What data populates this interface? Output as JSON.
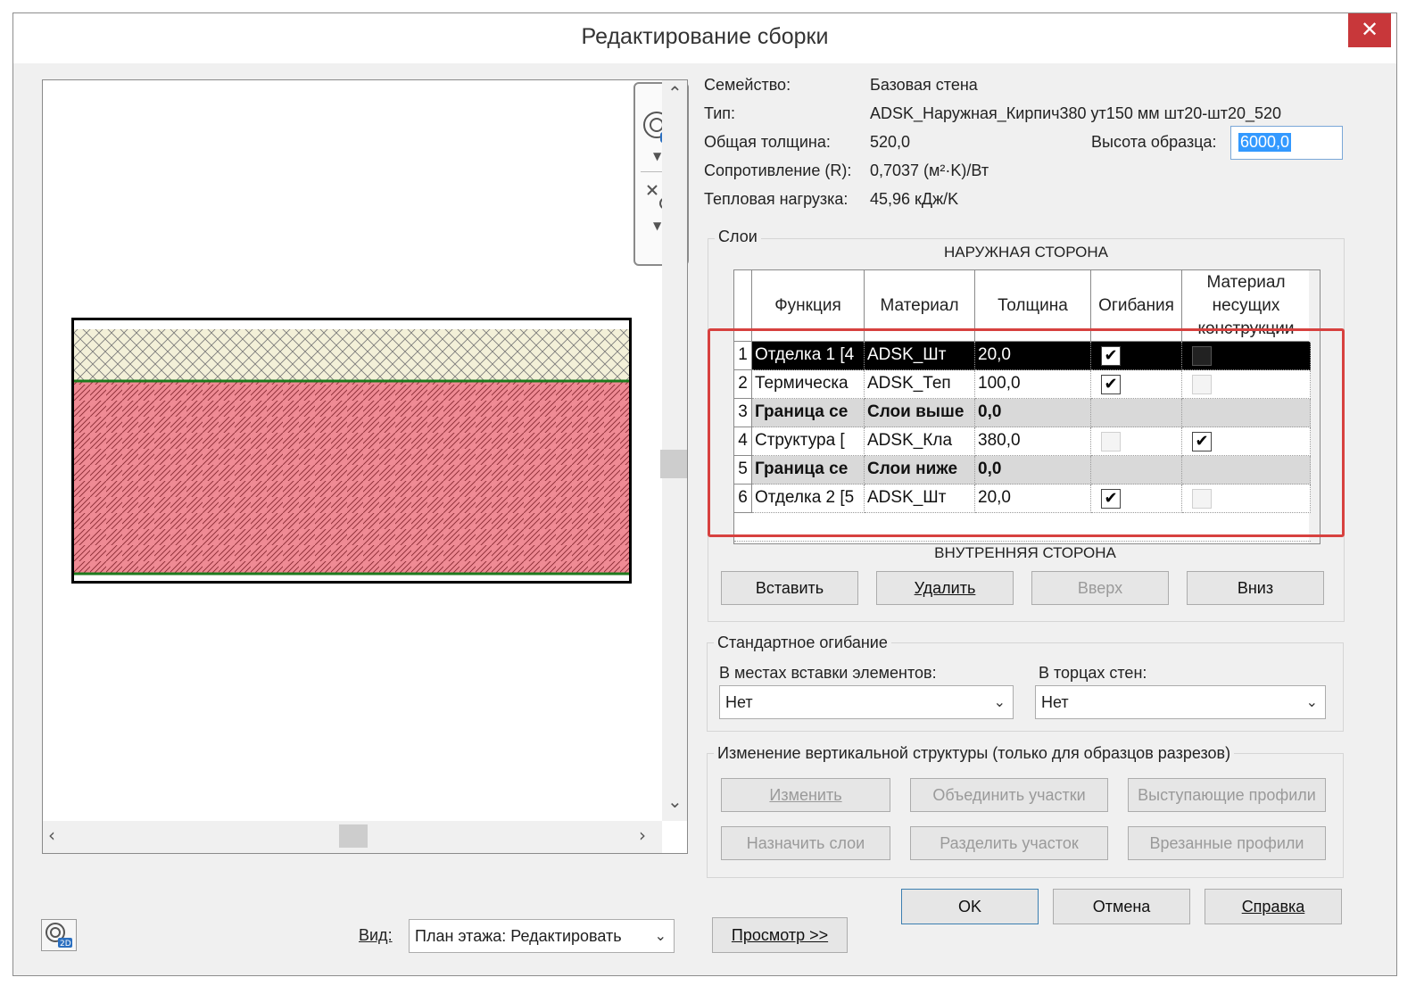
{
  "window": {
    "title": "Редактирование сборки",
    "close_glyph": "✕"
  },
  "info": {
    "family_label": "Семейство:",
    "family_value": "Базовая стена",
    "type_label": "Тип:",
    "type_value": "ADSK_Наружная_Кирпич380 ут150 мм шт20-шт20_520",
    "thickness_label": "Общая толщина:",
    "thickness_value": "520,0",
    "resistance_label": "Сопротивление (R):",
    "resistance_value": "0,7037 (м²·K)/Вт",
    "thermal_label": "Тепловая нагрузка:",
    "thermal_value": "45,96 кДж/K",
    "sample_height_label": "Высота образца:",
    "sample_height_value": "6000,0"
  },
  "layers": {
    "group_title": "Слои",
    "exterior_label": "НАРУЖНАЯ СТОРОНА",
    "interior_label": "ВНУТРЕННЯЯ СТОРОНА",
    "columns": [
      "Функция",
      "Материал",
      "Толщина",
      "Огибания",
      "Материал несущих конструкции"
    ],
    "rows": [
      {
        "num": "1",
        "function": "Отделка 1 [4",
        "material": "ADSK_Шт",
        "thickness": "20,0",
        "wrap": true,
        "structural": false,
        "selected": true,
        "bold": false
      },
      {
        "num": "2",
        "function": "Термическа",
        "material": "ADSK_Теп",
        "thickness": "100,0",
        "wrap": true,
        "structural": false,
        "selected": false,
        "bold": false
      },
      {
        "num": "3",
        "function": "Граница се",
        "material": "Слои выше",
        "thickness": "0,0",
        "wrap": null,
        "structural": null,
        "selected": false,
        "bold": true
      },
      {
        "num": "4",
        "function": "Структура [",
        "material": "ADSK_Кла",
        "thickness": "380,0",
        "wrap": false,
        "structural": true,
        "selected": false,
        "bold": false
      },
      {
        "num": "5",
        "function": "Граница се",
        "material": "Слои ниже",
        "thickness": "0,0",
        "wrap": null,
        "structural": null,
        "selected": false,
        "bold": true
      },
      {
        "num": "6",
        "function": "Отделка 2 [5",
        "material": "ADSK_Шт",
        "thickness": "20,0",
        "wrap": true,
        "structural": false,
        "selected": false,
        "bold": false
      }
    ],
    "buttons": {
      "insert": "Вставить",
      "delete": "Удалить",
      "up": "Вверх",
      "down": "Вниз"
    }
  },
  "wrapping": {
    "group_title": "Стандартное огибание",
    "inserts_label": "В местах вставки элементов:",
    "inserts_value": "Нет",
    "ends_label": "В торцах стен:",
    "ends_value": "Нет"
  },
  "vertical": {
    "group_title": "Изменение вертикальной структуры (только для образцов разрезов)",
    "modify": "Изменить",
    "merge": "Объединить участки",
    "sweeps": "Выступающие профили",
    "assign": "Назначить слои",
    "split": "Разделить участок",
    "reveals": "Врезанные профили"
  },
  "footer": {
    "ok": "OK",
    "cancel": "Отмена",
    "help": "Справка",
    "preview": "Просмотр >>",
    "view_label": "Вид:",
    "view_value": "План этажа: Редактировать"
  },
  "colors": {
    "finish_fill": "#f3f0d8",
    "insulation_fill": "#ef8a94",
    "border_green": "#1d7a1d",
    "highlight": "#d7413f",
    "selection": "#3399ff"
  },
  "icons": [
    "steering-wheel-2d-icon",
    "zoom-extents-icon",
    "close-icon",
    "chevron-down-icon"
  ]
}
